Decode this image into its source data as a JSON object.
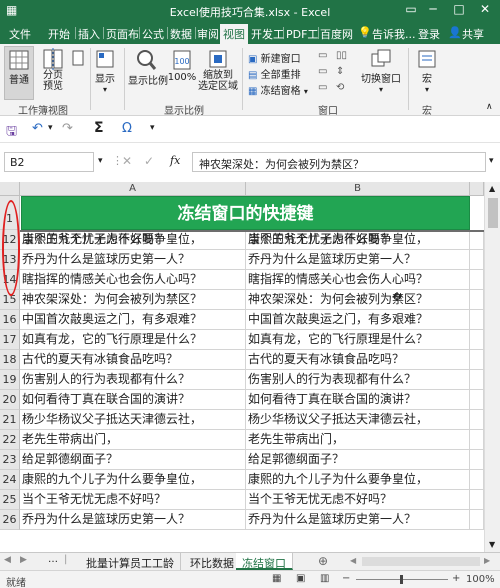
{
  "window": {
    "title": "Excel使用技巧合集.xlsx - Excel"
  },
  "tabs": [
    "文件",
    "开始",
    "插入",
    "页面布",
    "公式",
    "数据",
    "审阅",
    "视图",
    "开发工",
    "PDF工",
    "百度网"
  ],
  "active_tab": "视图",
  "tellme": "告诉我...",
  "login": "登录",
  "share": "共享",
  "ribbon": {
    "normal": "普通",
    "page_preview": "分页\n预览",
    "show": "显示",
    "show_ratio": "显示比例",
    "ratio100": "100%",
    "zoom_sel": "缩放到\n选定区域",
    "new_window": "新建窗口",
    "arrange_all": "全部重排",
    "freeze": "冻结窗格",
    "switch_window": "切换窗口",
    "macro": "宏",
    "grp_workbook_view": "工作簿视图",
    "grp_show_ratio": "显示比例",
    "grp_window": "窗口",
    "grp_macro": "宏"
  },
  "namebox": "B2",
  "formula": "神农架深处：为何会被列为禁区？",
  "fx": "fx",
  "columns": [
    "A",
    "B"
  ],
  "sheet_title": "冻结窗口的快捷键",
  "rows": [
    {
      "num": "1",
      "a": "",
      "b": ""
    },
    {
      "num": "11",
      "a": "康熙的九个儿子为什么要争皇位，",
      "b": "康熙的九个儿子为什么要争皇位，"
    },
    {
      "num": "12",
      "a": "当个王爷无忧无虑不好吗？",
      "b": "当个王爷无忧无虑不好吗？"
    },
    {
      "num": "13",
      "a": "乔丹为什么是篮球历史第一人？",
      "b": "乔丹为什么是篮球历史第一人？"
    },
    {
      "num": "14",
      "a": "瞎指挥的情感关心也会伤人心吗？",
      "b": "瞎指挥的情感关心也会伤人心吗？"
    },
    {
      "num": "15",
      "a": "神农架深处：为何会被列为禁区？",
      "b": "神农架深处：为何会被列为禁区？"
    },
    {
      "num": "16",
      "a": "中国首次敲奥运之门，有多艰难？",
      "b": "中国首次敲奥运之门，有多艰难？"
    },
    {
      "num": "17",
      "a": "如真有龙，它的飞行原理是什么？",
      "b": "如真有龙，它的飞行原理是什么？"
    },
    {
      "num": "18",
      "a": "古代的夏天有冰镇食品吃吗？",
      "b": "古代的夏天有冰镇食品吃吗？"
    },
    {
      "num": "19",
      "a": "伤害别人的行为表现都有什么？",
      "b": "伤害别人的行为表现都有什么？"
    },
    {
      "num": "20",
      "a": "如何看待丁真在联合国的演讲？",
      "b": "如何看待丁真在联合国的演讲？"
    },
    {
      "num": "21",
      "a": "杨少华杨议父子抵达天津德云社，",
      "b": "杨少华杨议父子抵达天津德云社，"
    },
    {
      "num": "22",
      "a": "老先生带病出门，",
      "b": "老先生带病出门，"
    },
    {
      "num": "23",
      "a": "给足郭德纲面子？",
      "b": "给足郭德纲面子？"
    },
    {
      "num": "24",
      "a": "康熙的九个儿子为什么要争皇位，",
      "b": "康熙的九个儿子为什么要争皇位，"
    },
    {
      "num": "25",
      "a": "当个王爷无忧无虑不好吗？",
      "b": "当个王爷无忧无虑不好吗？"
    },
    {
      "num": "26",
      "a": "乔丹为什么是篮球历史第一人？",
      "b": "乔丹为什么是篮球历史第一人？"
    }
  ],
  "sheets": [
    "批量计算员工工龄",
    "环比数据",
    "冻结窗口"
  ],
  "active_sheet": "冻结窗口",
  "status": {
    "ready": "就绪",
    "zoom": "100%"
  },
  "accent": "#217346",
  "title_fill": "#22a553"
}
